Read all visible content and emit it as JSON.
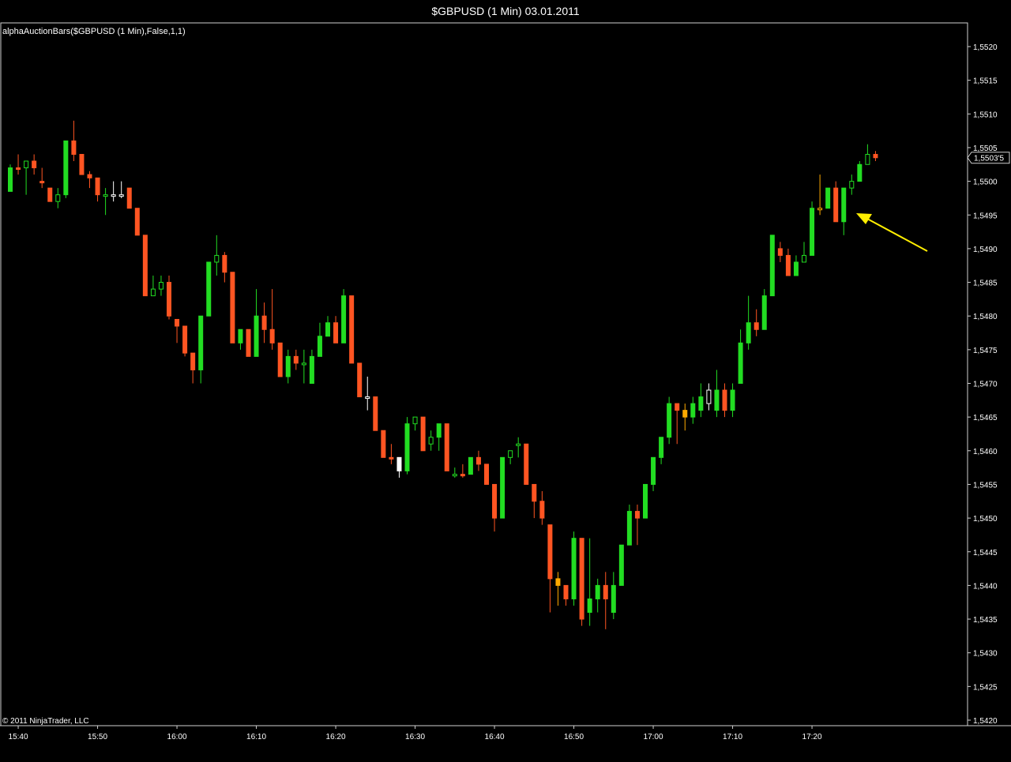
{
  "window": {
    "title": "$GBPUSD (1 Min)  03.01.2011"
  },
  "panel": {
    "indicator_label": "alphaAuctionBars($GBPUSD (1 Min),False,1,1)",
    "copyright": "© 2011 NinjaTrader, LLC",
    "last_price_label": "1,5503'5"
  },
  "chart_data": {
    "type": "candlestick",
    "title": "$GBPUSD (1 Min)  03.01.2011",
    "x_tick_labels": [
      "15:40",
      "15:50",
      "16:00",
      "16:10",
      "16:20",
      "16:30",
      "16:40",
      "16:50",
      "17:00",
      "17:10",
      "17:20"
    ],
    "y_tick_labels": [
      "1,5520",
      "1,5515",
      "1,5510",
      "1,5505",
      "1,5500",
      "1,5495",
      "1,5490",
      "1,5485",
      "1,5480",
      "1,5475",
      "1,5470",
      "1,5465",
      "1,5460",
      "1,5455",
      "1,5450",
      "1,5445",
      "1,5440",
      "1,5435",
      "1,5430",
      "1,5425",
      "1,5420"
    ],
    "ylim": [
      1.542,
      1.552
    ],
    "x_start_time": "15:39",
    "interval_minutes": 1,
    "last_price": 1.55035,
    "colors": {
      "up": "#22dd22",
      "down": "#ff5522",
      "neutral": "#ffffff",
      "highlight": "#ffaa00",
      "arrow": "#ffee00"
    },
    "bars": [
      {
        "o": 1.54985,
        "h": 1.55025,
        "l": 1.54985,
        "c": 1.5502,
        "k": "u"
      },
      {
        "o": 1.5502,
        "h": 1.5504,
        "l": 1.5501,
        "c": 1.5502,
        "k": "d"
      },
      {
        "o": 1.5502,
        "h": 1.5503,
        "l": 1.5498,
        "c": 1.5503,
        "k": "u"
      },
      {
        "o": 1.5503,
        "h": 1.5504,
        "l": 1.5501,
        "c": 1.5502,
        "k": "d"
      },
      {
        "o": 1.55,
        "h": 1.5502,
        "l": 1.5499,
        "c": 1.55,
        "k": "d"
      },
      {
        "o": 1.5499,
        "h": 1.5499,
        "l": 1.5497,
        "c": 1.5497,
        "k": "d"
      },
      {
        "o": 1.5497,
        "h": 1.5499,
        "l": 1.5496,
        "c": 1.5498,
        "k": "u"
      },
      {
        "o": 1.5498,
        "h": 1.5506,
        "l": 1.54975,
        "c": 1.5506,
        "k": "u"
      },
      {
        "o": 1.5506,
        "h": 1.5509,
        "l": 1.5503,
        "c": 1.5504,
        "k": "d"
      },
      {
        "o": 1.5504,
        "h": 1.5504,
        "l": 1.5501,
        "c": 1.5501,
        "k": "d"
      },
      {
        "o": 1.5501,
        "h": 1.55015,
        "l": 1.5499,
        "c": 1.55005,
        "k": "d"
      },
      {
        "o": 1.55005,
        "h": 1.55005,
        "l": 1.5497,
        "c": 1.5498,
        "k": "d"
      },
      {
        "o": 1.5498,
        "h": 1.5499,
        "l": 1.5495,
        "c": 1.5498,
        "k": "u"
      },
      {
        "o": 1.5498,
        "h": 1.55,
        "l": 1.5497,
        "c": 1.5498,
        "k": "n"
      },
      {
        "o": 1.5498,
        "h": 1.55,
        "l": 1.54975,
        "c": 1.5498,
        "k": "n"
      },
      {
        "o": 1.5499,
        "h": 1.5499,
        "l": 1.5496,
        "c": 1.5496,
        "k": "d"
      },
      {
        "o": 1.5496,
        "h": 1.5496,
        "l": 1.5492,
        "c": 1.5492,
        "k": "d"
      },
      {
        "o": 1.5492,
        "h": 1.5492,
        "l": 1.5483,
        "c": 1.5483,
        "k": "d"
      },
      {
        "o": 1.5483,
        "h": 1.5486,
        "l": 1.5483,
        "c": 1.5484,
        "k": "u"
      },
      {
        "o": 1.5484,
        "h": 1.5486,
        "l": 1.5483,
        "c": 1.5485,
        "k": "u"
      },
      {
        "o": 1.5485,
        "h": 1.5486,
        "l": 1.54795,
        "c": 1.548,
        "k": "d"
      },
      {
        "o": 1.54795,
        "h": 1.54795,
        "l": 1.5476,
        "c": 1.54785,
        "k": "d"
      },
      {
        "o": 1.54785,
        "h": 1.54785,
        "l": 1.5474,
        "c": 1.54745,
        "k": "d"
      },
      {
        "o": 1.54745,
        "h": 1.54745,
        "l": 1.547,
        "c": 1.5472,
        "k": "d"
      },
      {
        "o": 1.5472,
        "h": 1.548,
        "l": 1.547,
        "c": 1.548,
        "k": "u"
      },
      {
        "o": 1.548,
        "h": 1.5488,
        "l": 1.548,
        "c": 1.5488,
        "k": "u"
      },
      {
        "o": 1.5488,
        "h": 1.5492,
        "l": 1.5486,
        "c": 1.5489,
        "k": "u"
      },
      {
        "o": 1.5489,
        "h": 1.54895,
        "l": 1.5485,
        "c": 1.54865,
        "k": "d"
      },
      {
        "o": 1.54865,
        "h": 1.54865,
        "l": 1.5476,
        "c": 1.5476,
        "k": "d"
      },
      {
        "o": 1.5476,
        "h": 1.5478,
        "l": 1.5475,
        "c": 1.5478,
        "k": "u"
      },
      {
        "o": 1.5478,
        "h": 1.5478,
        "l": 1.5474,
        "c": 1.5474,
        "k": "d"
      },
      {
        "o": 1.5474,
        "h": 1.5484,
        "l": 1.5474,
        "c": 1.548,
        "k": "u"
      },
      {
        "o": 1.548,
        "h": 1.5482,
        "l": 1.5476,
        "c": 1.5478,
        "k": "d"
      },
      {
        "o": 1.5478,
        "h": 1.5484,
        "l": 1.5475,
        "c": 1.5476,
        "k": "d"
      },
      {
        "o": 1.5476,
        "h": 1.5476,
        "l": 1.5471,
        "c": 1.5471,
        "k": "d"
      },
      {
        "o": 1.5471,
        "h": 1.5475,
        "l": 1.547,
        "c": 1.5474,
        "k": "u"
      },
      {
        "o": 1.5474,
        "h": 1.5475,
        "l": 1.5472,
        "c": 1.5473,
        "k": "d"
      },
      {
        "o": 1.5473,
        "h": 1.5475,
        "l": 1.547,
        "c": 1.5473,
        "k": "u"
      },
      {
        "o": 1.547,
        "h": 1.5475,
        "l": 1.547,
        "c": 1.5474,
        "k": "u"
      },
      {
        "o": 1.5474,
        "h": 1.5479,
        "l": 1.5474,
        "c": 1.5477,
        "k": "u"
      },
      {
        "o": 1.5477,
        "h": 1.548,
        "l": 1.5477,
        "c": 1.5479,
        "k": "u"
      },
      {
        "o": 1.5479,
        "h": 1.548,
        "l": 1.5476,
        "c": 1.5476,
        "k": "d"
      },
      {
        "o": 1.5476,
        "h": 1.5484,
        "l": 1.5476,
        "c": 1.5483,
        "k": "u"
      },
      {
        "o": 1.5483,
        "h": 1.5483,
        "l": 1.5473,
        "c": 1.5473,
        "k": "d"
      },
      {
        "o": 1.5473,
        "h": 1.5473,
        "l": 1.5468,
        "c": 1.5468,
        "k": "d"
      },
      {
        "o": 1.5468,
        "h": 1.5471,
        "l": 1.5466,
        "c": 1.5468,
        "k": "n"
      },
      {
        "o": 1.5468,
        "h": 1.5468,
        "l": 1.5463,
        "c": 1.5463,
        "k": "d"
      },
      {
        "o": 1.5463,
        "h": 1.5463,
        "l": 1.5459,
        "c": 1.5459,
        "k": "d"
      },
      {
        "o": 1.5459,
        "h": 1.5461,
        "l": 1.5458,
        "c": 1.5459,
        "k": "d"
      },
      {
        "o": 1.5459,
        "h": 1.5459,
        "l": 1.5456,
        "c": 1.5457,
        "k": "n"
      },
      {
        "o": 1.5457,
        "h": 1.5465,
        "l": 1.54565,
        "c": 1.5464,
        "k": "u"
      },
      {
        "o": 1.5464,
        "h": 1.5465,
        "l": 1.5463,
        "c": 1.5465,
        "k": "u"
      },
      {
        "o": 1.5465,
        "h": 1.5465,
        "l": 1.546,
        "c": 1.546,
        "k": "d"
      },
      {
        "o": 1.5461,
        "h": 1.5463,
        "l": 1.546,
        "c": 1.5462,
        "k": "u"
      },
      {
        "o": 1.5462,
        "h": 1.5464,
        "l": 1.546,
        "c": 1.5464,
        "k": "u"
      },
      {
        "o": 1.5464,
        "h": 1.5464,
        "l": 1.5457,
        "c": 1.5457,
        "k": "d"
      },
      {
        "o": 1.54565,
        "h": 1.54575,
        "l": 1.5456,
        "c": 1.54565,
        "k": "u"
      },
      {
        "o": 1.54565,
        "h": 1.5458,
        "l": 1.5456,
        "c": 1.54565,
        "k": "d"
      },
      {
        "o": 1.54565,
        "h": 1.5459,
        "l": 1.54565,
        "c": 1.5459,
        "k": "u"
      },
      {
        "o": 1.5459,
        "h": 1.546,
        "l": 1.5457,
        "c": 1.5458,
        "k": "d"
      },
      {
        "o": 1.5458,
        "h": 1.5458,
        "l": 1.5455,
        "c": 1.5455,
        "k": "d"
      },
      {
        "o": 1.5455,
        "h": 1.5455,
        "l": 1.5448,
        "c": 1.545,
        "k": "d"
      },
      {
        "o": 1.545,
        "h": 1.5459,
        "l": 1.545,
        "c": 1.5459,
        "k": "u"
      },
      {
        "o": 1.5459,
        "h": 1.546,
        "l": 1.5458,
        "c": 1.546,
        "k": "u"
      },
      {
        "o": 1.5461,
        "h": 1.5462,
        "l": 1.5459,
        "c": 1.5461,
        "k": "u"
      },
      {
        "o": 1.5461,
        "h": 1.5461,
        "l": 1.5455,
        "c": 1.5455,
        "k": "d"
      },
      {
        "o": 1.5455,
        "h": 1.5455,
        "l": 1.545,
        "c": 1.54525,
        "k": "d"
      },
      {
        "o": 1.54525,
        "h": 1.5454,
        "l": 1.5449,
        "c": 1.545,
        "k": "d"
      },
      {
        "o": 1.5449,
        "h": 1.5449,
        "l": 1.5436,
        "c": 1.5441,
        "k": "d"
      },
      {
        "o": 1.5441,
        "h": 1.5442,
        "l": 1.5437,
        "c": 1.544,
        "k": "h"
      },
      {
        "o": 1.544,
        "h": 1.544,
        "l": 1.5437,
        "c": 1.5438,
        "k": "d"
      },
      {
        "o": 1.5438,
        "h": 1.5448,
        "l": 1.5437,
        "c": 1.5447,
        "k": "u"
      },
      {
        "o": 1.5447,
        "h": 1.5447,
        "l": 1.5434,
        "c": 1.5435,
        "k": "d"
      },
      {
        "o": 1.5436,
        "h": 1.5447,
        "l": 1.5434,
        "c": 1.5438,
        "k": "u"
      },
      {
        "o": 1.5438,
        "h": 1.5441,
        "l": 1.5436,
        "c": 1.544,
        "k": "u"
      },
      {
        "o": 1.544,
        "h": 1.5442,
        "l": 1.54335,
        "c": 1.5438,
        "k": "d"
      },
      {
        "o": 1.5436,
        "h": 1.5442,
        "l": 1.5435,
        "c": 1.544,
        "k": "u"
      },
      {
        "o": 1.544,
        "h": 1.5446,
        "l": 1.544,
        "c": 1.5446,
        "k": "u"
      },
      {
        "o": 1.5446,
        "h": 1.5452,
        "l": 1.5446,
        "c": 1.5451,
        "k": "u"
      },
      {
        "o": 1.5451,
        "h": 1.5452,
        "l": 1.5446,
        "c": 1.545,
        "k": "d"
      },
      {
        "o": 1.545,
        "h": 1.5455,
        "l": 1.545,
        "c": 1.5455,
        "k": "u"
      },
      {
        "o": 1.5455,
        "h": 1.5459,
        "l": 1.5454,
        "c": 1.5459,
        "k": "u"
      },
      {
        "o": 1.5459,
        "h": 1.5462,
        "l": 1.5458,
        "c": 1.5462,
        "k": "u"
      },
      {
        "o": 1.5462,
        "h": 1.5468,
        "l": 1.5461,
        "c": 1.5467,
        "k": "u"
      },
      {
        "o": 1.5467,
        "h": 1.5467,
        "l": 1.5461,
        "c": 1.5466,
        "k": "d"
      },
      {
        "o": 1.5466,
        "h": 1.5467,
        "l": 1.5463,
        "c": 1.5465,
        "k": "h"
      },
      {
        "o": 1.5465,
        "h": 1.5468,
        "l": 1.5464,
        "c": 1.5467,
        "k": "u"
      },
      {
        "o": 1.5466,
        "h": 1.547,
        "l": 1.5465,
        "c": 1.5468,
        "k": "u"
      },
      {
        "o": 1.5467,
        "h": 1.547,
        "l": 1.5466,
        "c": 1.5469,
        "k": "n"
      },
      {
        "o": 1.5466,
        "h": 1.5472,
        "l": 1.5465,
        "c": 1.5469,
        "k": "u"
      },
      {
        "o": 1.5469,
        "h": 1.547,
        "l": 1.5465,
        "c": 1.5466,
        "k": "d"
      },
      {
        "o": 1.5466,
        "h": 1.547,
        "l": 1.5465,
        "c": 1.5469,
        "k": "u"
      },
      {
        "o": 1.547,
        "h": 1.5478,
        "l": 1.547,
        "c": 1.5476,
        "k": "u"
      },
      {
        "o": 1.5476,
        "h": 1.5483,
        "l": 1.5475,
        "c": 1.5479,
        "k": "u"
      },
      {
        "o": 1.5479,
        "h": 1.5481,
        "l": 1.5477,
        "c": 1.5478,
        "k": "d"
      },
      {
        "o": 1.5478,
        "h": 1.5484,
        "l": 1.5478,
        "c": 1.5483,
        "k": "u"
      },
      {
        "o": 1.5483,
        "h": 1.5492,
        "l": 1.5483,
        "c": 1.5492,
        "k": "u"
      },
      {
        "o": 1.549,
        "h": 1.5491,
        "l": 1.5488,
        "c": 1.5489,
        "k": "d"
      },
      {
        "o": 1.5489,
        "h": 1.549,
        "l": 1.5486,
        "c": 1.5486,
        "k": "d"
      },
      {
        "o": 1.5486,
        "h": 1.5489,
        "l": 1.5486,
        "c": 1.5488,
        "k": "u"
      },
      {
        "o": 1.5488,
        "h": 1.5491,
        "l": 1.5488,
        "c": 1.5489,
        "k": "u"
      },
      {
        "o": 1.5489,
        "h": 1.5497,
        "l": 1.5489,
        "c": 1.5496,
        "k": "u"
      },
      {
        "o": 1.5496,
        "h": 1.5501,
        "l": 1.5495,
        "c": 1.5496,
        "k": "h"
      },
      {
        "o": 1.5496,
        "h": 1.5499,
        "l": 1.5496,
        "c": 1.5499,
        "k": "u"
      },
      {
        "o": 1.5499,
        "h": 1.55,
        "l": 1.5494,
        "c": 1.5494,
        "k": "d"
      },
      {
        "o": 1.5494,
        "h": 1.5499,
        "l": 1.5492,
        "c": 1.5499,
        "k": "u"
      },
      {
        "o": 1.5499,
        "h": 1.5501,
        "l": 1.5498,
        "c": 1.55,
        "k": "u"
      },
      {
        "o": 1.55,
        "h": 1.5503,
        "l": 1.55,
        "c": 1.55025,
        "k": "u"
      },
      {
        "o": 1.55025,
        "h": 1.55055,
        "l": 1.55025,
        "c": 1.5504,
        "k": "u"
      },
      {
        "o": 1.5504,
        "h": 1.55045,
        "l": 1.5503,
        "c": 1.55035,
        "k": "d"
      }
    ]
  }
}
